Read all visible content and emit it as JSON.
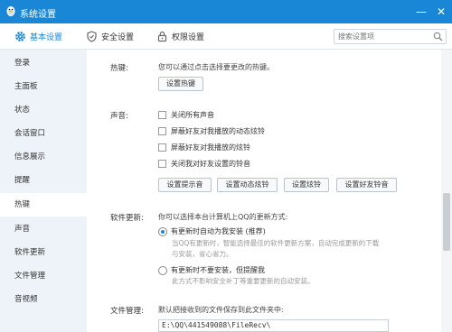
{
  "window": {
    "title": "系统设置",
    "minimize_glyph": "—",
    "close_glyph": "✕"
  },
  "tabs": [
    {
      "label": "基本设置",
      "icon": "gear-icon",
      "active": true
    },
    {
      "label": "安全设置",
      "icon": "shield-icon",
      "active": false
    },
    {
      "label": "权限设置",
      "icon": "lock-icon",
      "active": false
    }
  ],
  "search": {
    "placeholder": "搜索设置项",
    "value": ""
  },
  "sidebar": {
    "items": [
      {
        "label": "登录"
      },
      {
        "label": "主面板"
      },
      {
        "label": "状态"
      },
      {
        "label": "会话窗口"
      },
      {
        "label": "信息展示"
      },
      {
        "label": "提醒"
      },
      {
        "label": "热键",
        "active": true
      },
      {
        "label": "声音"
      },
      {
        "label": "软件更新"
      },
      {
        "label": "文件管理"
      },
      {
        "label": "音视频"
      }
    ]
  },
  "hotkey": {
    "label": "热键:",
    "desc": "您可以通过点击选择要更改的热键。",
    "button": "设置热键"
  },
  "sound": {
    "label": "声音:",
    "options": [
      {
        "label": "关闭所有声音",
        "checked": false
      },
      {
        "label": "屏蔽好友对我播放的动态炫铃",
        "checked": false
      },
      {
        "label": "屏蔽好友对我播放的炫铃",
        "checked": false
      },
      {
        "label": "关闭我对好友设置的铃音",
        "checked": false
      }
    ],
    "buttons": [
      "设置提示音",
      "设置动态炫铃",
      "设置炫铃",
      "设置好友铃音"
    ]
  },
  "update": {
    "label": "软件更新:",
    "desc": "你可以选择本台计算机上QQ的更新方式:",
    "auto_label": "有更新时自动为我安装 (推荐)",
    "auto_note1": "当QQ有更新时，智能选择最佳的软件更新方案，自动完成更新的下载",
    "auto_note2": "与安装，省心省力。",
    "manual_label": "有更新时不要安装，但提醒我",
    "manual_note": "此方式不影响安全补丁等重要更新的自动安装。",
    "selected": "auto"
  },
  "filemgmt": {
    "label": "文件管理:",
    "desc": "默认把接收到的文件保存到此文件夹中:",
    "path": "E:\\QQ\\441549088\\FileRecv\\"
  },
  "colors": {
    "accent": "#1a87d6",
    "sidebar_bg": "#edf3f8"
  }
}
